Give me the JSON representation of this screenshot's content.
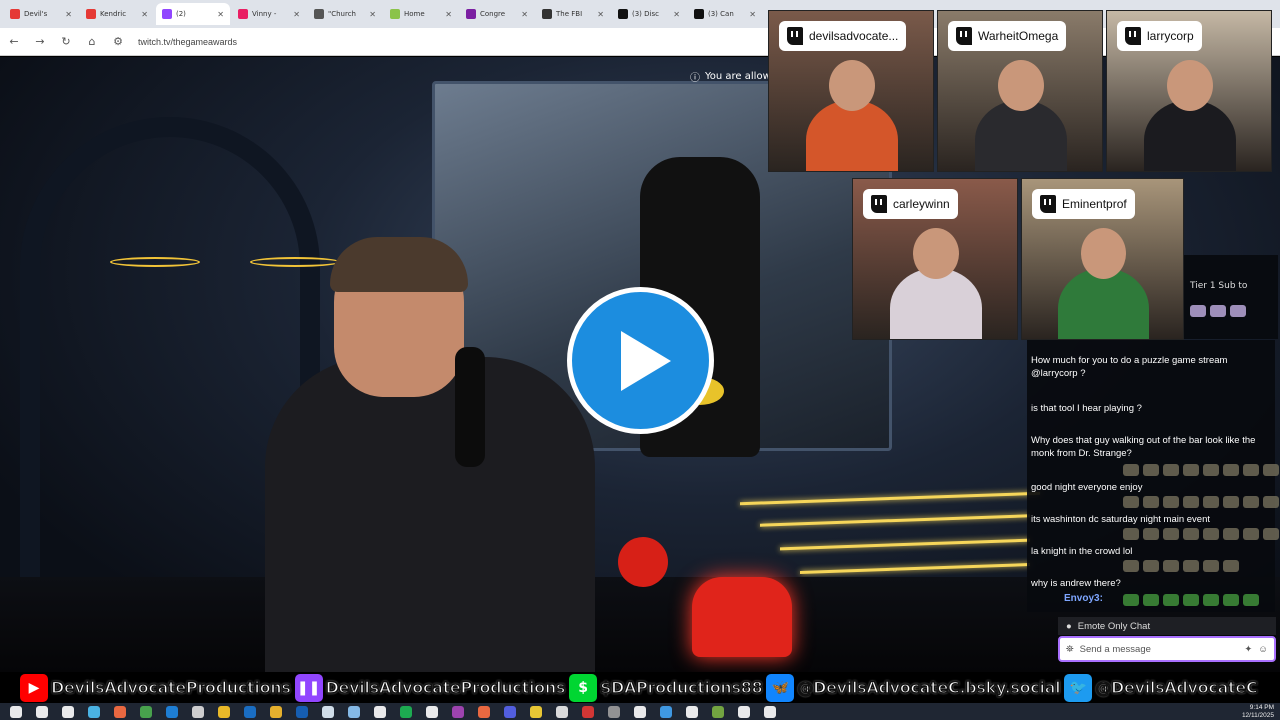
{
  "browser": {
    "tabs": [
      {
        "label": "Devil's",
        "color": "#e53935",
        "active": false
      },
      {
        "label": "Kendric",
        "color": "#e53935",
        "active": false
      },
      {
        "label": "(2)",
        "color": "#9146ff",
        "active": true
      },
      {
        "label": "Vinny -",
        "color": "#e91e63",
        "active": false
      },
      {
        "label": "\"Church",
        "color": "#555555",
        "active": false
      },
      {
        "label": "Home",
        "color": "#8bc34a",
        "active": false
      },
      {
        "label": "Congre",
        "color": "#7b1fa2",
        "active": false
      },
      {
        "label": "The FBI",
        "color": "#333333",
        "active": false
      },
      {
        "label": "(3) Disc",
        "color": "#111111",
        "active": false
      },
      {
        "label": "(3) Can",
        "color": "#111111",
        "active": false
      }
    ],
    "url": "twitch.tv/thegameawards"
  },
  "video": {
    "banner_text": "You are allowe"
  },
  "webcams": [
    {
      "name": "devilsadvocate...",
      "bg": "#7a5a4a",
      "shirt": "#d4562a"
    },
    {
      "name": "WarheitOmega",
      "bg": "#8a7b6a",
      "shirt": "#2a2a2e"
    },
    {
      "name": "larrycorp",
      "bg": "#c5b8a5",
      "shirt": "#1b1b1f"
    },
    {
      "name": "carleywinn",
      "bg": "#8a5a4a",
      "shirt": "#d9d0d8"
    },
    {
      "name": "Eminentprof",
      "bg": "#a8957a",
      "shirt": "#2f7a3a"
    }
  ],
  "side_snippet": {
    "line1": "Tier 1 Sub to"
  },
  "chat": {
    "messages": [
      {
        "text": "How much for you to do a puzzle game stream @larrycorp ?"
      },
      {
        "text": "is that tool I hear playing ?"
      },
      {
        "text": "Why does that guy walking out of the bar look like the monk from Dr. Strange?"
      },
      {
        "text": "good night everyone enjoy"
      },
      {
        "text": "its washinton dc saturday night main event"
      },
      {
        "text": "la knight in the crowd lol"
      },
      {
        "text": "why is andrew there?"
      }
    ],
    "envoy_user": "Envoy3:",
    "mode_label": "Emote Only Chat",
    "input_placeholder": "Send a message"
  },
  "social": [
    {
      "icon": "youtube-icon",
      "glyph": "▶",
      "color": "#ff0000",
      "text": "DevilsAdvocateProductions"
    },
    {
      "icon": "twitch-icon",
      "glyph": "❚❚",
      "color": "#9146ff",
      "text": "DevilsAdvocateProductions"
    },
    {
      "icon": "cashapp-icon",
      "glyph": "$",
      "color": "#00d632",
      "text": "$DAProductions88"
    },
    {
      "icon": "bluesky-icon",
      "glyph": "🦋",
      "color": "#1185fe",
      "text": "@DevilsAdvocateC.bsky.social"
    },
    {
      "icon": "twitter-icon",
      "glyph": "🐦",
      "color": "#1d9bf0",
      "text": "@DevilsAdvocateC"
    }
  ],
  "taskbar": {
    "time": "9:14 PM",
    "date": "12/11/2025",
    "icon_colors": [
      "#ffffff",
      "#ffffff",
      "#ffffff",
      "#4fc3f7",
      "#ff7043",
      "#4caf50",
      "#1e88e5",
      "#e0e0e0",
      "#ffca28",
      "#1976d2",
      "#fbc02d",
      "#1565c0",
      "#e3f2fd",
      "#90caf9",
      "#ffffff",
      "#1db954",
      "#ffffff",
      "#ab47bc",
      "#ff7043",
      "#5865f2",
      "#fdd835",
      "#eeeeee",
      "#e53935",
      "#9e9e9e",
      "#ffffff",
      "#42a5f5",
      "#ffffff",
      "#7cb342",
      "#ffffff",
      "#ffffff"
    ]
  }
}
